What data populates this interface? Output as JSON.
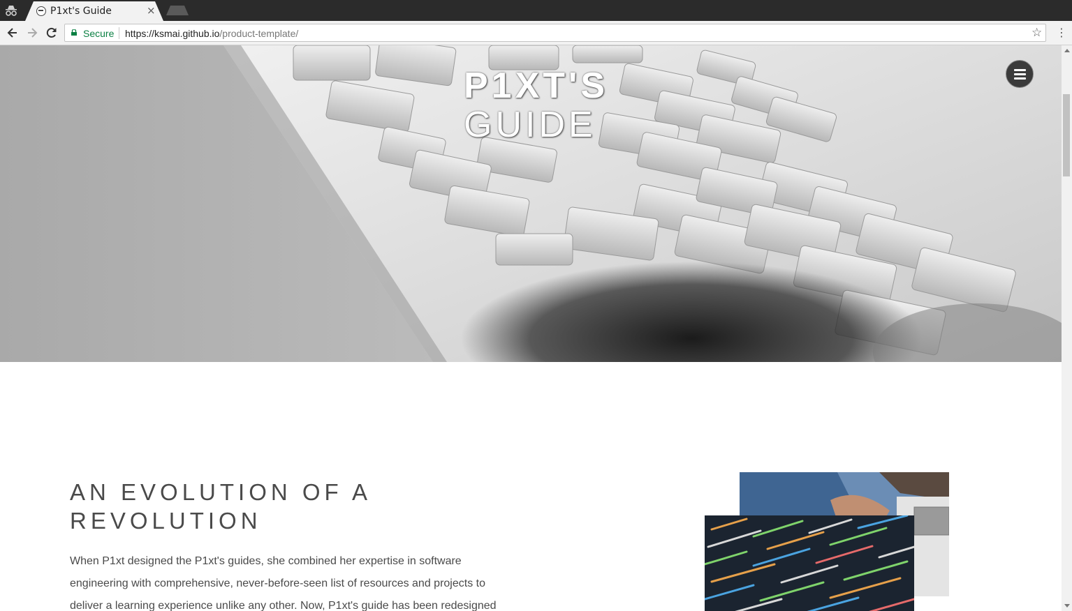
{
  "browser": {
    "tab_title": "P1xt's Guide",
    "tab_close": "×",
    "secure_label": "Secure",
    "url_host": "https://ksmai.github.io",
    "url_path": "/product-template/",
    "star": "☆",
    "menu": "⋮"
  },
  "icons": {
    "incognito": "incognito-icon",
    "back": "back-arrow-icon",
    "forward": "forward-arrow-icon",
    "reload": "reload-icon",
    "lock": "lock-icon",
    "star": "star-icon",
    "menu": "hamburger-menu-icon"
  },
  "hero": {
    "title_line1": "P1XT'S",
    "title_line2": "GUIDE"
  },
  "section": {
    "heading": "AN EVOLUTION OF A REVOLUTION",
    "body": "When P1xt designed the P1xt's guides, she combined her expertise in software engineering with comprehensive, never-before-seen list of resources and projects to deliver a learning experience unlike any other. Now, P1xt's guide has been redesigned"
  },
  "colors": {
    "secure_green": "#0b8043",
    "heading_text": "#4a4a4a",
    "hamburger_bg": "#3b3b3b"
  }
}
